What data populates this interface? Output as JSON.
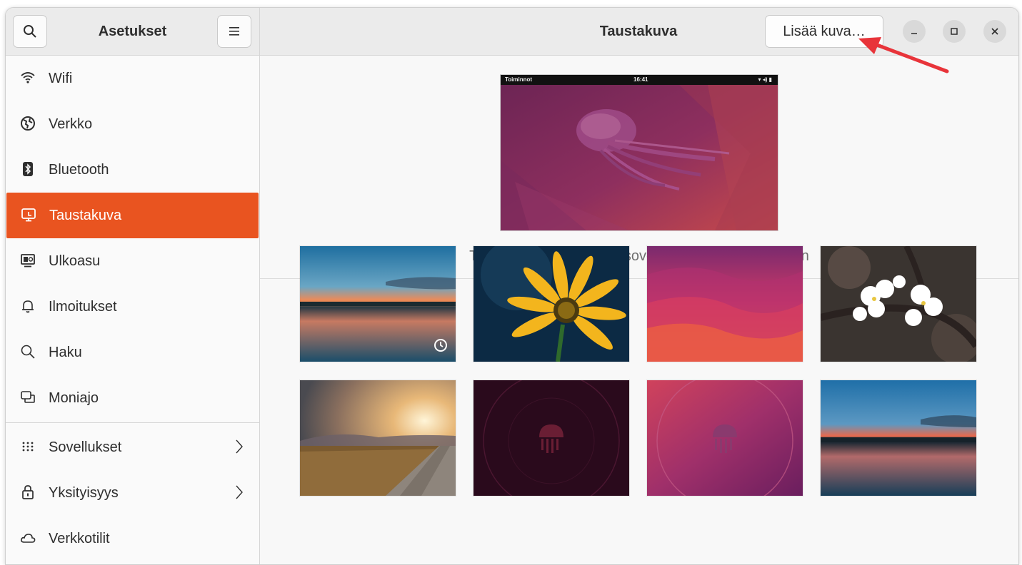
{
  "sidebar": {
    "title": "Asetukset",
    "search_icon": "search-icon",
    "menu_icon": "hamburger-menu-icon",
    "items": [
      {
        "label": "Wifi",
        "icon": "wifi-icon"
      },
      {
        "label": "Verkko",
        "icon": "globe-icon"
      },
      {
        "label": "Bluetooth",
        "icon": "bluetooth-icon"
      },
      {
        "label": "Taustakuva",
        "icon": "monitor-icon",
        "active": true
      },
      {
        "label": "Ulkoasu",
        "icon": "appearance-icon"
      },
      {
        "label": "Ilmoitukset",
        "icon": "bell-icon"
      },
      {
        "label": "Haku",
        "icon": "search-icon"
      },
      {
        "label": "Moniajo",
        "icon": "windows-icon"
      },
      {
        "label": "Sovellukset",
        "icon": "grid-icon",
        "chevron": true
      },
      {
        "label": "Yksityisyys",
        "icon": "lock-icon",
        "chevron": true
      },
      {
        "label": "Verkkotilit",
        "icon": "cloud-icon"
      }
    ]
  },
  "header": {
    "title": "Taustakuva",
    "add_button": "Lisää kuva…",
    "window_controls": [
      "minimize-icon",
      "maximize-icon",
      "close-icon"
    ]
  },
  "preview": {
    "topbar_left": "Toiminnot",
    "topbar_center": "16:41",
    "caption": "Tämä taustakuvavalinta soveltuu vain vaaleaan tyyliin"
  },
  "wallpapers": [
    {
      "name": "sunset-lake",
      "time_based": true
    },
    {
      "name": "yellow-flower"
    },
    {
      "name": "magenta-waves"
    },
    {
      "name": "cherry-blossom"
    },
    {
      "name": "sunny-field"
    },
    {
      "name": "dark-jellyfish"
    },
    {
      "name": "pink-jellyfish"
    },
    {
      "name": "blue-lake"
    }
  ],
  "colors": {
    "accent": "#e95420",
    "header_bg": "#ebebeb",
    "annotation_arrow": "#e8343a"
  }
}
